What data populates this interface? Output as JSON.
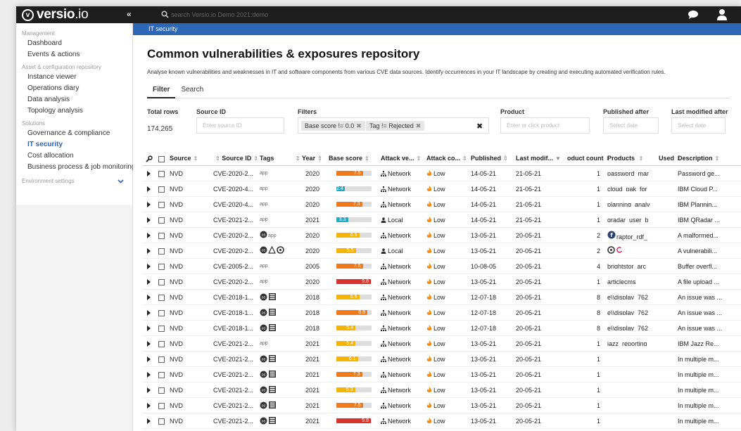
{
  "app": {
    "logo_mark": "v",
    "logo_name": "versio",
    "logo_suffix": ".io",
    "collapse": "«"
  },
  "search": {
    "placeholder": "search Versio.io Demo 2021:demo"
  },
  "sidebar": {
    "groups": [
      {
        "label": "Management",
        "items": [
          "Dashboard",
          "Events & actions"
        ]
      },
      {
        "label": "Asset & configuration repository",
        "items": [
          "Instance viewer",
          "Operations diary",
          "Data analysis",
          "Topology analysis"
        ]
      },
      {
        "label": "Solutions",
        "items": [
          "Governance & compliance",
          "IT security",
          "Cost allocation",
          "Business process & job monitoring"
        ]
      }
    ],
    "active_item": "IT security",
    "env_label": "Environment settings"
  },
  "breadcrumb": "IT security",
  "page": {
    "title": "Common vulnerabilities & exposures repository",
    "description": "Analyse known vulnerabilities and weaknesses in IT and software components from various CVE data sources. Identify occurrences in your IT landscape by creating and executing automated verification rules."
  },
  "tabs": [
    "Filter",
    "Search"
  ],
  "filters": {
    "total_rows_label": "Total rows",
    "total_rows_value": "174,265",
    "source_id_label": "Source ID",
    "source_id_placeholder": "Enter source ID",
    "filters_label": "Filters",
    "chips": [
      "Base score != 0.0",
      "Tag != Rejected"
    ],
    "chip_remove": "✖",
    "clear": "✖",
    "product_label": "Product",
    "product_placeholder": "Enter or click product",
    "published_label": "Published after",
    "published_placeholder": "Select date",
    "modified_label": "Last modified after",
    "modified_placeholder": "Select date"
  },
  "table": {
    "headers": {
      "source": "Source",
      "source_id": "Source ID",
      "tags": "Tags",
      "year": "Year",
      "base_score": "Base score",
      "attack_vector": "Attack ve...",
      "attack_complexity": "Attack co...",
      "published": "Published",
      "last_modified": "Last modif...",
      "product_count": "oduct count",
      "products": "Products",
      "used": "Used",
      "description": "Description"
    },
    "sort_glyph": "⇕",
    "sort_desc_glyph": "▼",
    "rows": [
      {
        "source": "NVD",
        "source_id": "CVE-2020-2...",
        "tags": "app",
        "tag_icons": [],
        "year": "2020",
        "score": "7.5",
        "score_num": 7.5,
        "vector": "Network",
        "complexity": "Low",
        "published": "14-05-21",
        "modified": "21-05-21",
        "count": "1",
        "product": "password_mar",
        "product_icons": [],
        "description": "Password ge..."
      },
      {
        "source": "NVD",
        "source_id": "CVE-2020-4...",
        "tags": "app",
        "tag_icons": [],
        "year": "2020",
        "score": "2.4",
        "score_num": 2.4,
        "vector": "Network",
        "complexity": "Low",
        "published": "14-05-21",
        "modified": "21-05-21",
        "count": "1",
        "product": "cloud_pak_for_",
        "product_icons": [],
        "description": "IBM Cloud P..."
      },
      {
        "source": "NVD",
        "source_id": "CVE-2020-4...",
        "tags": "app",
        "tag_icons": [],
        "year": "2020",
        "score": "7.3",
        "score_num": 7.3,
        "vector": "Network",
        "complexity": "Low",
        "published": "14-05-21",
        "modified": "21-05-21",
        "count": "1",
        "product": "planning_analy",
        "product_icons": [],
        "description": "IBM Plannin..."
      },
      {
        "source": "NVD",
        "source_id": "CVE-2021-2...",
        "tags": "app",
        "tag_icons": [],
        "year": "2021",
        "score": "3.3",
        "score_num": 3.3,
        "vector": "Local",
        "complexity": "Low",
        "published": "14-05-21",
        "modified": "21-05-21",
        "count": "1",
        "product": "qradar_user_b",
        "product_icons": [],
        "description": "IBM QRadar ..."
      },
      {
        "source": "NVD",
        "source_id": "CVE-2020-2...",
        "tags": "app",
        "tag_icons": [
          "os-icon"
        ],
        "year": "2020",
        "score": "6.5",
        "score_num": 6.5,
        "vector": "Network",
        "complexity": "Low",
        "published": "13-05-21",
        "modified": "20-05-21",
        "count": "2",
        "product": "raptor_rdf_",
        "product_icons": [
          "fedora-icon"
        ],
        "description": "A malformed..."
      },
      {
        "source": "NVD",
        "source_id": "CVE-2020-2...",
        "tags": "",
        "tag_icons": [
          "os-icon",
          "linux-icon",
          "ubuntu-icon"
        ],
        "year": "2020",
        "score": "5.5",
        "score_num": 5.5,
        "vector": "Local",
        "complexity": "Low",
        "published": "13-05-21",
        "modified": "20-05-21",
        "count": "2",
        "product": "",
        "product_icons": [
          "ubuntu-icon",
          "debian-icon"
        ],
        "description": "A vulnerabili..."
      },
      {
        "source": "NVD",
        "source_id": "CVE-2005-2...",
        "tags": "app",
        "tag_icons": [],
        "year": "2005",
        "score": "7.5",
        "score_num": 7.5,
        "vector": "Network",
        "complexity": "Low",
        "published": "10-08-05",
        "modified": "20-05-21",
        "count": "4",
        "product": "brightstor_arc",
        "product_icons": [],
        "description": "Buffer overfl..."
      },
      {
        "source": "NVD",
        "source_id": "CVE-2020-2...",
        "tags": "app",
        "tag_icons": [],
        "year": "2020",
        "score": "9.8",
        "score_num": 9.8,
        "vector": "Network",
        "complexity": "Low",
        "published": "13-05-21",
        "modified": "20-05-21",
        "count": "1",
        "product": "articlecms",
        "product_icons": [],
        "description": "A file upload ..."
      },
      {
        "source": "NVD",
        "source_id": "CVE-2018-1...",
        "tags": "",
        "tag_icons": [
          "os-icon",
          "hardware-icon"
        ],
        "year": "2018",
        "score": "6.5",
        "score_num": 6.5,
        "vector": "Network",
        "complexity": "Low",
        "published": "12-07-18",
        "modified": "20-05-21",
        "count": "8",
        "product": "e\\\\display_762",
        "product_icons": [],
        "description": "An issue was ..."
      },
      {
        "source": "NVD",
        "source_id": "CVE-2018-1...",
        "tags": "",
        "tag_icons": [
          "os-icon",
          "hardware-icon"
        ],
        "year": "2018",
        "score": "8.8",
        "score_num": 8.8,
        "vector": "Network",
        "complexity": "Low",
        "published": "12-07-18",
        "modified": "20-05-21",
        "count": "8",
        "product": "e\\\\display_762",
        "product_icons": [],
        "description": "An issue was ..."
      },
      {
        "source": "NVD",
        "source_id": "CVE-2018-1...",
        "tags": "",
        "tag_icons": [
          "os-icon",
          "hardware-icon"
        ],
        "year": "2018",
        "score": "5.4",
        "score_num": 5.4,
        "vector": "Network",
        "complexity": "Low",
        "published": "12-07-18",
        "modified": "20-05-21",
        "count": "8",
        "product": "e\\\\display_762",
        "product_icons": [],
        "description": "An issue was ..."
      },
      {
        "source": "NVD",
        "source_id": "CVE-2021-2...",
        "tags": "app",
        "tag_icons": [],
        "year": "2021",
        "score": "5.4",
        "score_num": 5.4,
        "vector": "Network",
        "complexity": "Low",
        "published": "13-05-21",
        "modified": "20-05-21",
        "count": "1",
        "product": "jazz_reporting",
        "product_icons": [],
        "description": "IBM Jazz Re..."
      },
      {
        "source": "NVD",
        "source_id": "CVE-2021-2...",
        "tags": "",
        "tag_icons": [
          "os-icon",
          "hardware-icon"
        ],
        "year": "2021",
        "score": "6.1",
        "score_num": 6.1,
        "vector": "Network",
        "complexity": "Low",
        "published": "13-05-21",
        "modified": "20-05-21",
        "count": "1",
        "product": "",
        "product_icons": [],
        "description": "In multiple m..."
      },
      {
        "source": "NVD",
        "source_id": "CVE-2021-2...",
        "tags": "",
        "tag_icons": [
          "os-icon",
          "hardware-icon"
        ],
        "year": "2021",
        "score": "7.3",
        "score_num": 7.3,
        "vector": "Network",
        "complexity": "Low",
        "published": "13-05-21",
        "modified": "20-05-21",
        "count": "1",
        "product": "",
        "product_icons": [],
        "description": "In multiple m..."
      },
      {
        "source": "NVD",
        "source_id": "CVE-2021-2...",
        "tags": "",
        "tag_icons": [
          "os-icon",
          "hardware-icon"
        ],
        "year": "2021",
        "score": "5.3",
        "score_num": 5.3,
        "vector": "Network",
        "complexity": "Low",
        "published": "13-05-21",
        "modified": "20-05-21",
        "count": "1",
        "product": "",
        "product_icons": [],
        "description": "In multiple m..."
      },
      {
        "source": "NVD",
        "source_id": "CVE-2021-2...",
        "tags": "",
        "tag_icons": [
          "os-icon",
          "hardware-icon"
        ],
        "year": "2021",
        "score": "7.5",
        "score_num": 7.5,
        "vector": "Network",
        "complexity": "Low",
        "published": "13-05-21",
        "modified": "20-05-21",
        "count": "1",
        "product": "",
        "product_icons": [],
        "description": "In multiple m..."
      },
      {
        "source": "NVD",
        "source_id": "CVE-2021-2...",
        "tags": "",
        "tag_icons": [
          "os-icon",
          "hardware-icon"
        ],
        "year": "2021",
        "score": "9.8",
        "score_num": 9.8,
        "vector": "Network",
        "complexity": "Low",
        "published": "13-05-21",
        "modified": "20-05-21",
        "count": "1",
        "product": "",
        "product_icons": [],
        "description": "In multiple m..."
      },
      {
        "source": "NVD",
        "source_id": "CVE-2021-2...",
        "tags": "",
        "tag_icons": [
          "os-icon",
          "hardware-icon"
        ],
        "year": "2021",
        "score": "5.3",
        "score_num": 5.3,
        "vector": "Network",
        "complexity": "Low",
        "published": "13-05-21",
        "modified": "20-05-21",
        "count": "1",
        "product": "",
        "product_icons": [],
        "description": "In multiple m..."
      }
    ]
  },
  "colors": {
    "brand_bar": "#2e66b8",
    "topbar": "#1e1e1e",
    "score_low": "#26a9c6",
    "score_medium": "#f4b400",
    "score_high": "#f07a1a",
    "score_critical": "#d9312b",
    "flame": "#f08a1a"
  }
}
